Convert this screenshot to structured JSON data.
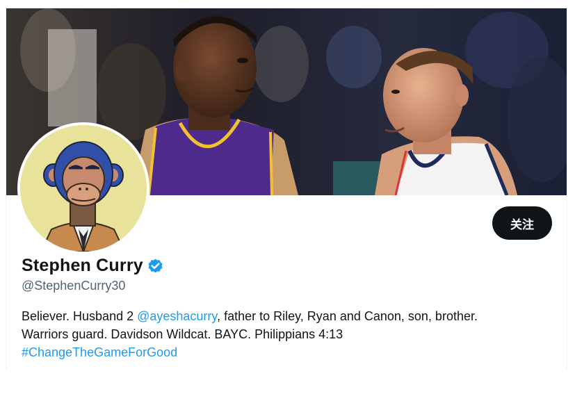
{
  "profile": {
    "display_name": "Stephen Curry",
    "handle": "@StephenCurry30",
    "verified": true,
    "follow_label": "关注",
    "banner_icon": "banner-photo",
    "avatar_icon": "bored-ape-avatar"
  },
  "bio": {
    "part1": "Believer. Husband 2 ",
    "mention": "@ayeshacurry",
    "part2": ", father to Riley, Ryan and Canon, son, brother.",
    "line2": "Warriors guard. Davidson Wildcat. BAYC. Philippians 4:13",
    "hashtag": "#ChangeTheGameForGood"
  },
  "colors": {
    "accent": "#1d9bf0",
    "text_primary": "#0f1419",
    "text_secondary": "#536471",
    "button_bg": "#0f1419",
    "avatar_bg": "#e8e29a"
  }
}
